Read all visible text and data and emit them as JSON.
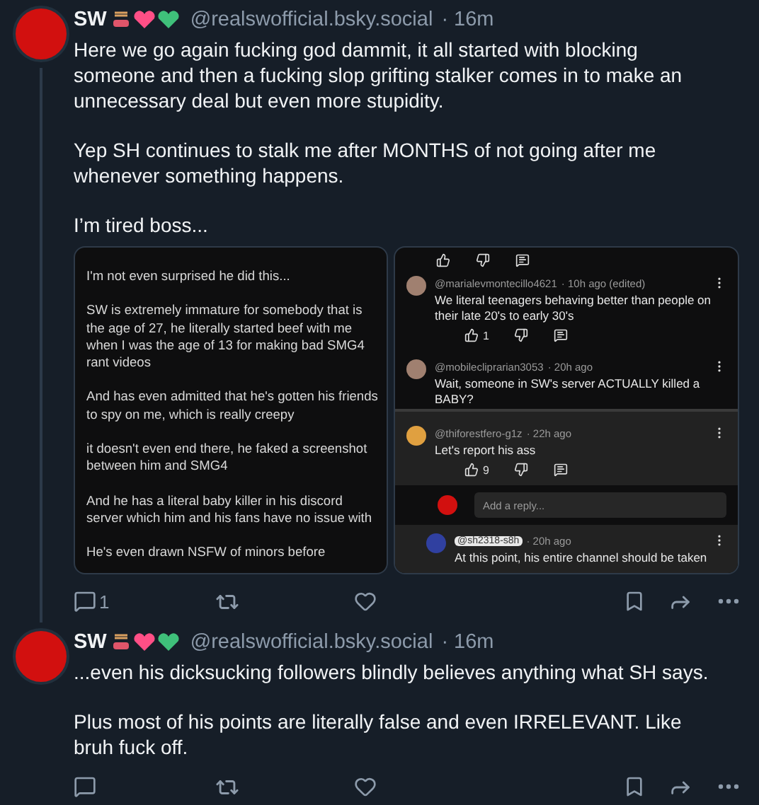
{
  "posts": [
    {
      "author": "SW",
      "handle": "@realswofficial.bsky.social",
      "time": "· 16m",
      "thread_line": true,
      "paragraphs": [
        "Here we go again fucking god dammit, it all started with blocking someone and then a fucking slop grifting stalker comes in to make an unnecessary deal but even more stupidity.",
        "Yep SH continues to stalk me after MONTHS of not going after me whenever something happens.",
        "I’m tired boss..."
      ],
      "screenshots": {
        "notes": [
          "I'm not even surprised he did this...",
          "SW is extremely immature for somebody that is the age of 27, he literally started beef with me when I was the age of 13 for making bad SMG4 rant videos",
          "And has even admitted that he's gotten his friends to spy on me, which is really creepy",
          "it doesn't even end there, he faked a screenshot between him and SMG4",
          "And he has a literal baby killer in his discord server which him and his fans have no issue with",
          "He's even drawn NSFW of minors before"
        ],
        "comments": [
          {
            "handle": "@marialevmontecillo4621",
            "meta": "· 10h ago (edited)",
            "text": "We literal teenagers behaving better than people on their late 20's to early 30's",
            "likes": "1"
          },
          {
            "handle": "@mobilecliprarian3053",
            "meta": "· 20h ago",
            "text": "Wait, someone in SW's server ACTUALLY killed a BABY?"
          }
        ],
        "thread": {
          "handle": "@thiforestfero-g1z",
          "meta": "· 22h ago",
          "text": "Let's report his ass",
          "likes": "9",
          "reply_placeholder": "Add a reply...",
          "reply": {
            "handle": "@sh2318-s8h",
            "meta": "· 20h ago",
            "text": "At this point, his entire channel should be taken"
          }
        }
      },
      "replies": "1"
    },
    {
      "author": "SW",
      "handle": "@realswofficial.bsky.social",
      "time": "· 16m",
      "thread_line": false,
      "paragraphs": [
        "...even his dicksucking followers blindly believes anything what SH says.",
        "Plus most of his points are literally false and even IRRELEVANT. Like bruh fuck off."
      ]
    }
  ]
}
